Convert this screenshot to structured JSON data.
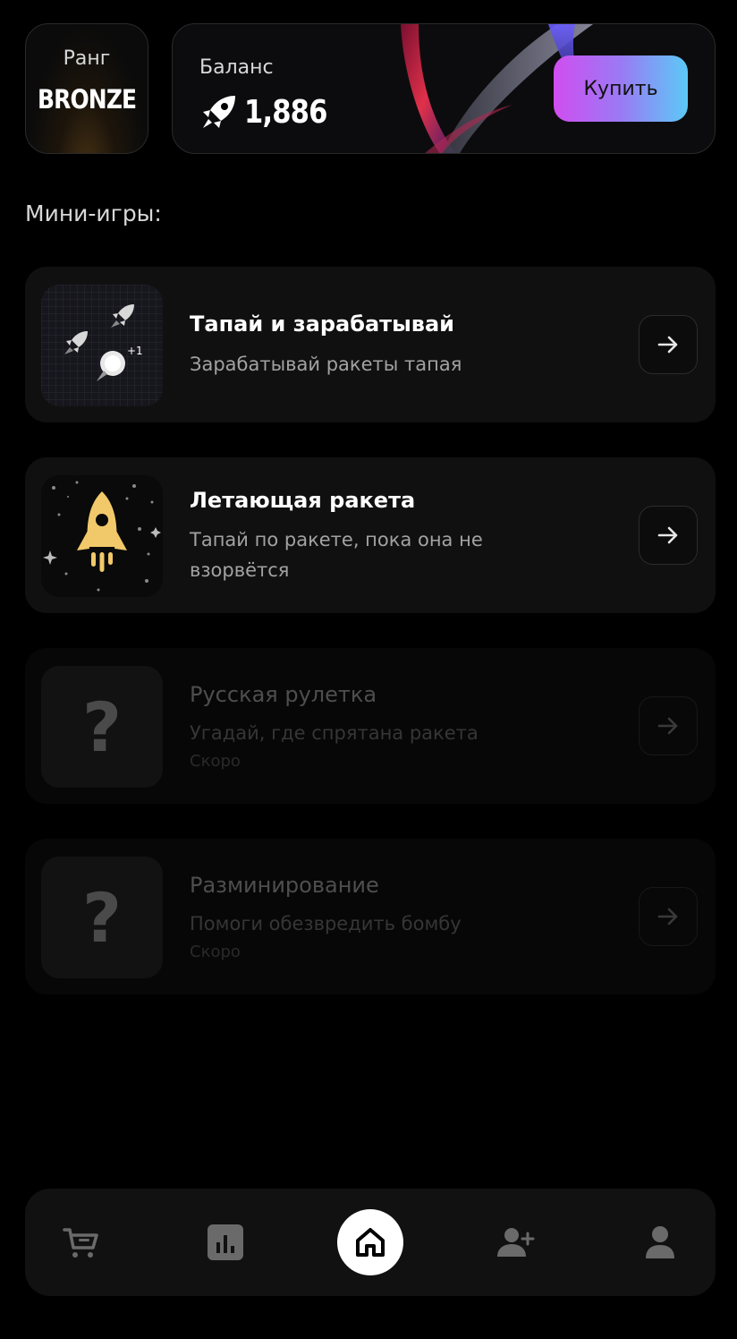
{
  "rank": {
    "label": "Ранг",
    "value": "BRONZE"
  },
  "balance": {
    "label": "Баланс",
    "value": "1,886",
    "icon": "rocket-icon",
    "buy_label": "Купить"
  },
  "section_title": "Мини-игры:",
  "games": [
    {
      "title": "Тапай и зарабатывай",
      "description": "Зарабатывай ракеты тапая",
      "badge": "+1",
      "enabled": true
    },
    {
      "title": "Летающая ракета",
      "description": "Тапай по ракете, пока она не взорвётся",
      "enabled": true
    },
    {
      "title": "Русская рулетка",
      "description": "Угадай, где спрятана ракета",
      "status": "Скоро",
      "placeholder_glyph": "?",
      "enabled": false
    },
    {
      "title": "Разминирование",
      "description": "Помоги обезвредить бомбу",
      "status": "Скоро",
      "placeholder_glyph": "?",
      "enabled": false
    }
  ],
  "nav": [
    {
      "name": "shop",
      "icon": "cart-icon",
      "active": false
    },
    {
      "name": "stats",
      "icon": "chart-icon",
      "active": false
    },
    {
      "name": "home",
      "icon": "home-icon",
      "active": true
    },
    {
      "name": "invite",
      "icon": "add-user-icon",
      "active": false
    },
    {
      "name": "profile",
      "icon": "user-icon",
      "active": false
    }
  ],
  "colors": {
    "background": "#000000",
    "card": "#101010",
    "buy_gradient_start": "#d04ef0",
    "buy_gradient_end": "#5cc9f7",
    "rocket_gold": "#f2c96a"
  }
}
